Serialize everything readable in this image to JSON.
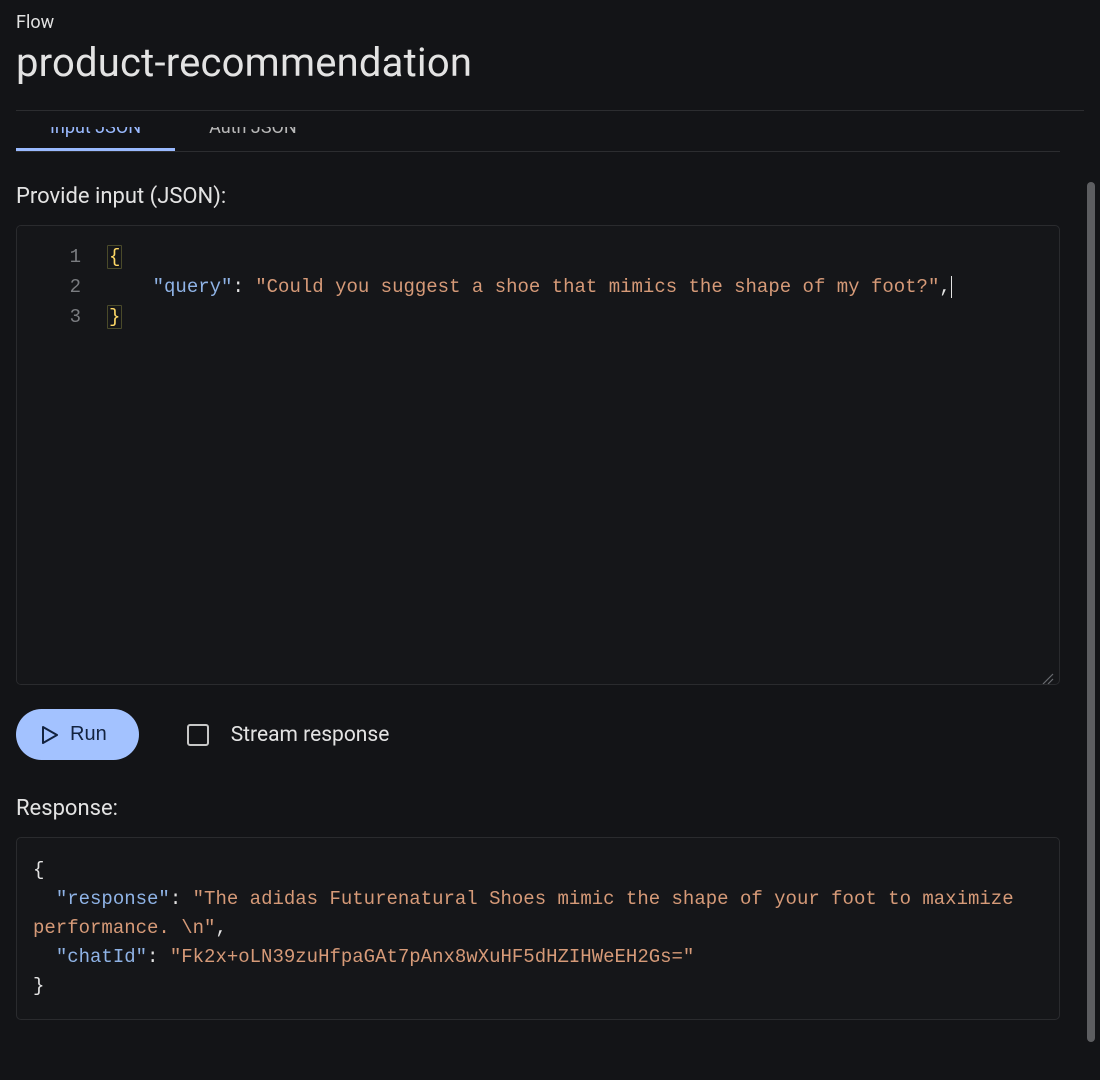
{
  "breadcrumb": "Flow",
  "title": "product-recommendation",
  "tabs": {
    "input": "Input JSON",
    "auth": "Auth JSON",
    "active": "input"
  },
  "input_section": {
    "label": "Provide input (JSON):",
    "gutter": [
      "1",
      "2",
      "3"
    ],
    "line1_open": "{",
    "line2_key": "\"query\"",
    "line2_sep": ": ",
    "line2_val": "\"Could you suggest a shoe that mimics the shape of my foot?\"",
    "line2_trail": ",",
    "line3_close": "}"
  },
  "controls": {
    "run_label": "Run",
    "stream_label": "Stream response",
    "stream_checked": false
  },
  "response_section": {
    "label": "Response:",
    "line1": "{",
    "line2_key": "\"response\"",
    "line2_sep": ": ",
    "line2_val": "\"The adidas Futurenatural Shoes mimic the shape of your foot to maximize performance. \\n\"",
    "line2_trail": ",",
    "line3_key": "\"chatId\"",
    "line3_sep": ": ",
    "line3_val": "\"Fk2x+oLN39zuHfpaGAt7pAnx8wXuHF5dHZIHWeEH2Gs=\"",
    "line4": "}"
  }
}
